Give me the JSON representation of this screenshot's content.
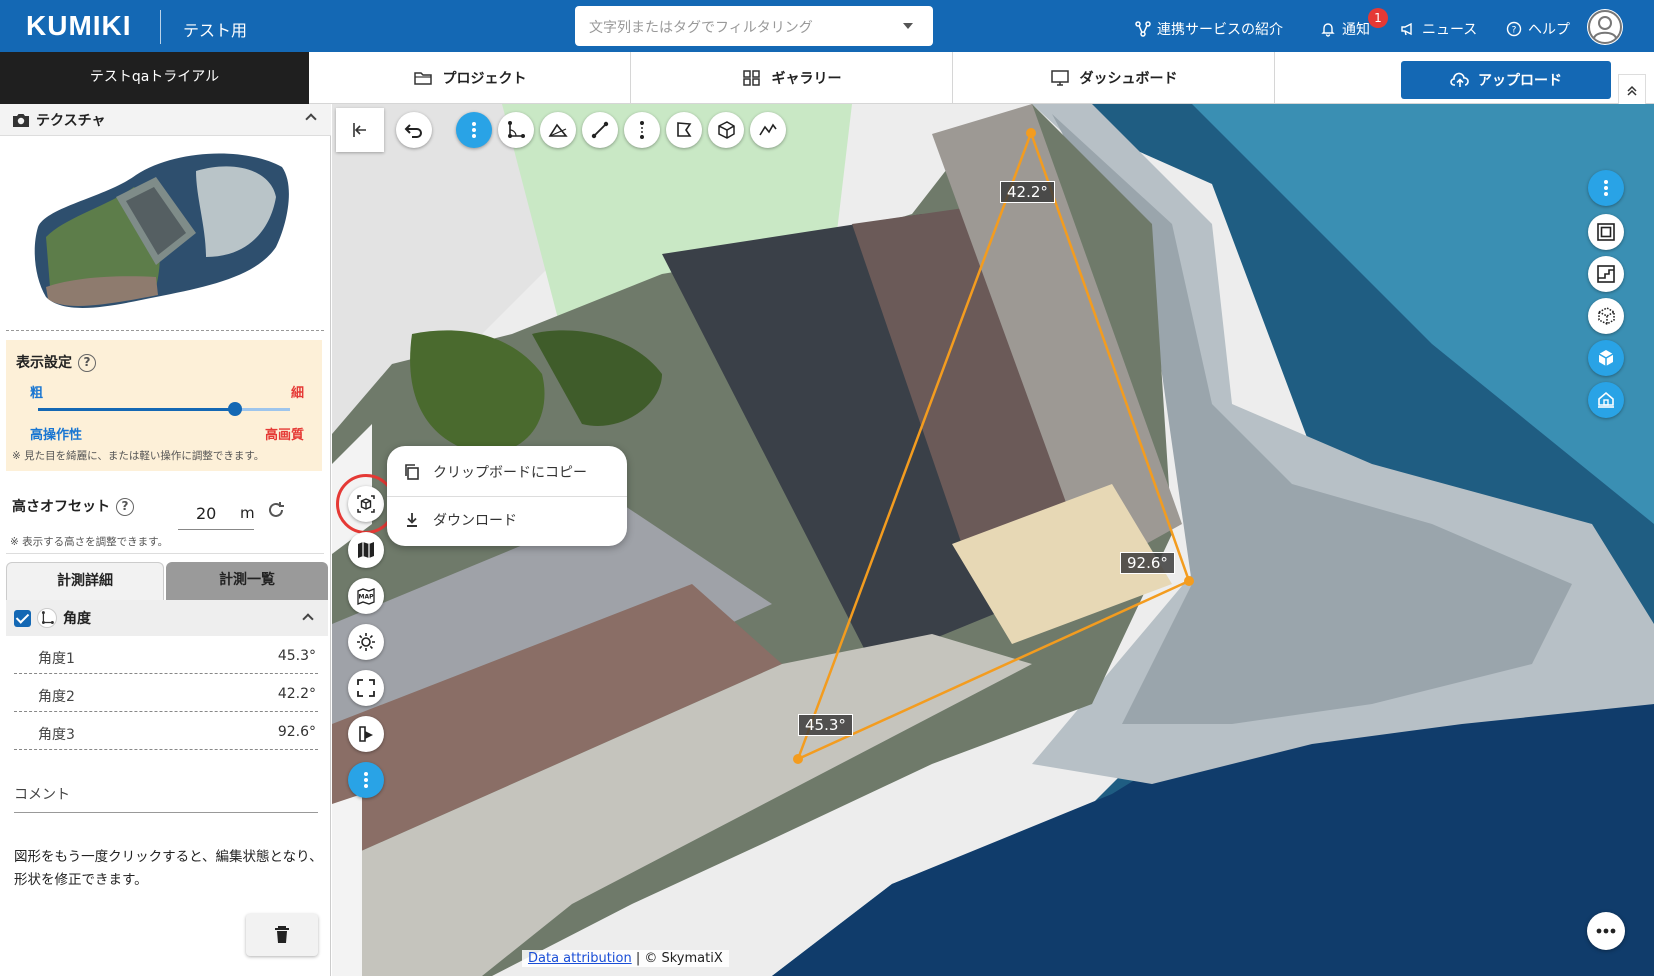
{
  "header": {
    "logo": "KUMIKI",
    "project": "テスト用",
    "filter_placeholder": "文字列またはタグでフィルタリング",
    "links": {
      "services": "連携サービスの紹介",
      "notify": "通知",
      "news": "ニュース",
      "help": "ヘルプ"
    },
    "notify_count": "1"
  },
  "nav": {
    "trial": "テストqaトライアル",
    "tabs": [
      "プロジェクト",
      "ギャラリー",
      "ダッシュボード"
    ],
    "upload": "アップロード"
  },
  "panel": {
    "texture_title": "テクスチャ",
    "display": {
      "title": "表示設定",
      "coarse": "粗",
      "fine": "細",
      "ops": "高操作性",
      "quality": "高画質",
      "note": "※ 見た目を綺麗に、または軽い操作に調整できます。",
      "slider_fraction": 0.78
    },
    "height": {
      "label": "高さオフセット",
      "value": "20",
      "unit": "m",
      "note": "※ 表示する高さを調整できます。"
    },
    "tabs": [
      "計測詳細",
      "計測一覧"
    ],
    "angle": {
      "title": "角度",
      "rows": [
        {
          "name": "角度1",
          "value": "45.3°"
        },
        {
          "name": "角度2",
          "value": "42.2°"
        },
        {
          "name": "角度3",
          "value": "92.6°"
        }
      ]
    },
    "comment_label": "コメント",
    "hint": "図形をもう一度クリックすると、編集状態となり、形状を修正できます。"
  },
  "map": {
    "popup": {
      "copy": "クリップボードにコピー",
      "download": "ダウンロード"
    },
    "angles": {
      "a": "45.3°",
      "b": "42.2°",
      "c": "92.6°"
    },
    "attribution_link": "Data attribution",
    "attribution_text": " | © SkymatiX",
    "map_btn_text": "MAP"
  },
  "colors": {
    "brand": "#1468b4",
    "accent": "#29a3e6",
    "measure_line": "#f39c1f",
    "highlight": "#e53935"
  }
}
